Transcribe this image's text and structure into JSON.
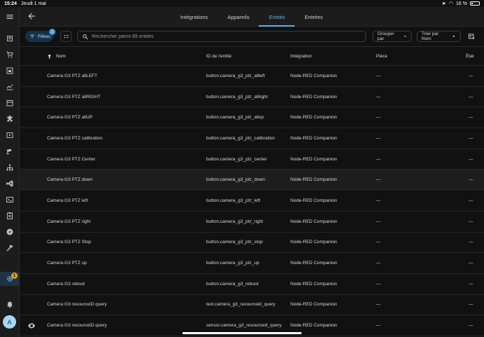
{
  "statusbar": {
    "time": "15:24",
    "date": "Jeudi 1 mai",
    "battery": "16 %"
  },
  "sidebar": {
    "items": [
      {
        "icon": "menu-icon"
      },
      {
        "icon": "overview-icon"
      },
      {
        "icon": "shopping-cart-icon"
      },
      {
        "icon": "energy-icon"
      },
      {
        "icon": "chart-icon"
      },
      {
        "icon": "calendar-icon"
      },
      {
        "icon": "puzzle-icon"
      },
      {
        "icon": "media-icon"
      },
      {
        "icon": "camera-icon"
      },
      {
        "icon": "network-icon"
      },
      {
        "icon": "vscode-icon"
      },
      {
        "icon": "terminal-icon"
      },
      {
        "icon": "clipboard-icon"
      },
      {
        "icon": "compass-icon"
      },
      {
        "icon": "hammer-icon"
      },
      {
        "icon": "gear-icon"
      }
    ],
    "settings_badge": "1",
    "notifications_icon": "bell-icon",
    "avatar_letter": "A"
  },
  "tabs": [
    {
      "label": "Intégrations",
      "active": false
    },
    {
      "label": "Appareils",
      "active": false
    },
    {
      "label": "Entités",
      "active": true
    },
    {
      "label": "Entrées",
      "active": false
    }
  ],
  "toolbar": {
    "filters_label": "Filtres",
    "filters_count": "1",
    "search_placeholder": "Rechercher parmi 85 entités",
    "group_by": "Grouper par",
    "sort_by": "Trier par Nom"
  },
  "table": {
    "headers": {
      "name": "Nom",
      "entity_id": "ID de l'entité",
      "integration": "Intégration",
      "area": "Pièce",
      "status": "État"
    },
    "rows": [
      {
        "name": "Camera G3 PTZ allLEFT",
        "entity_id": "button.camera_g3_ptz_allleft",
        "integration": "Node-RED Companion",
        "area": "—",
        "status": "—"
      },
      {
        "name": "Camera G3 PTZ allRIGHT",
        "entity_id": "button.camera_g3_ptz_allright",
        "integration": "Node-RED Companion",
        "area": "—",
        "status": "—"
      },
      {
        "name": "Camera G3 PTZ allUP",
        "entity_id": "button.camera_g3_ptz_allup",
        "integration": "Node-RED Companion",
        "area": "—",
        "status": "—"
      },
      {
        "name": "Camera G3 PTZ calibration",
        "entity_id": "button.camera_g3_ptz_calibration",
        "integration": "Node-RED Companion",
        "area": "—",
        "status": "—"
      },
      {
        "name": "Camera G3 PTZ Center",
        "entity_id": "button.camera_g3_ptz_center",
        "integration": "Node-RED Companion",
        "area": "—",
        "status": "—"
      },
      {
        "name": "Camera G3 PTZ down",
        "entity_id": "button.camera_g3_ptz_down",
        "integration": "Node-RED Companion",
        "area": "—",
        "status": "—"
      },
      {
        "name": "Camera G3 PTZ left",
        "entity_id": "button.camera_g3_ptz_left",
        "integration": "Node-RED Companion",
        "area": "—",
        "status": "—"
      },
      {
        "name": "Camera G3 PTZ right",
        "entity_id": "button.camera_g3_ptz_right",
        "integration": "Node-RED Companion",
        "area": "—",
        "status": "—"
      },
      {
        "name": "Camera G3 PTZ Stop",
        "entity_id": "button.camera_g3_ptz_stop",
        "integration": "Node-RED Companion",
        "area": "—",
        "status": "—"
      },
      {
        "name": "Camera G3 PTZ up",
        "entity_id": "button.camera_g3_ptz_up",
        "integration": "Node-RED Companion",
        "area": "—",
        "status": "—"
      },
      {
        "name": "Camera G3 reboot",
        "entity_id": "button.camera_g3_reboot",
        "integration": "Node-RED Companion",
        "area": "—",
        "status": "—"
      },
      {
        "name": "Camera G3 resourceID query",
        "entity_id": "text.camera_g3_resourceid_query",
        "integration": "Node-RED Companion",
        "area": "—",
        "status": "—"
      },
      {
        "name": "Camera G3 resourceID query",
        "entity_id": "sensor.camera_g3_resourceid_query",
        "integration": "Node-RED Companion",
        "area": "—",
        "status": "—",
        "icon": "eye-icon"
      }
    ]
  },
  "colors": {
    "accent": "#5bb3ea",
    "badge": "#ff9800",
    "background": "#111111",
    "surface": "#1c1c1c"
  }
}
